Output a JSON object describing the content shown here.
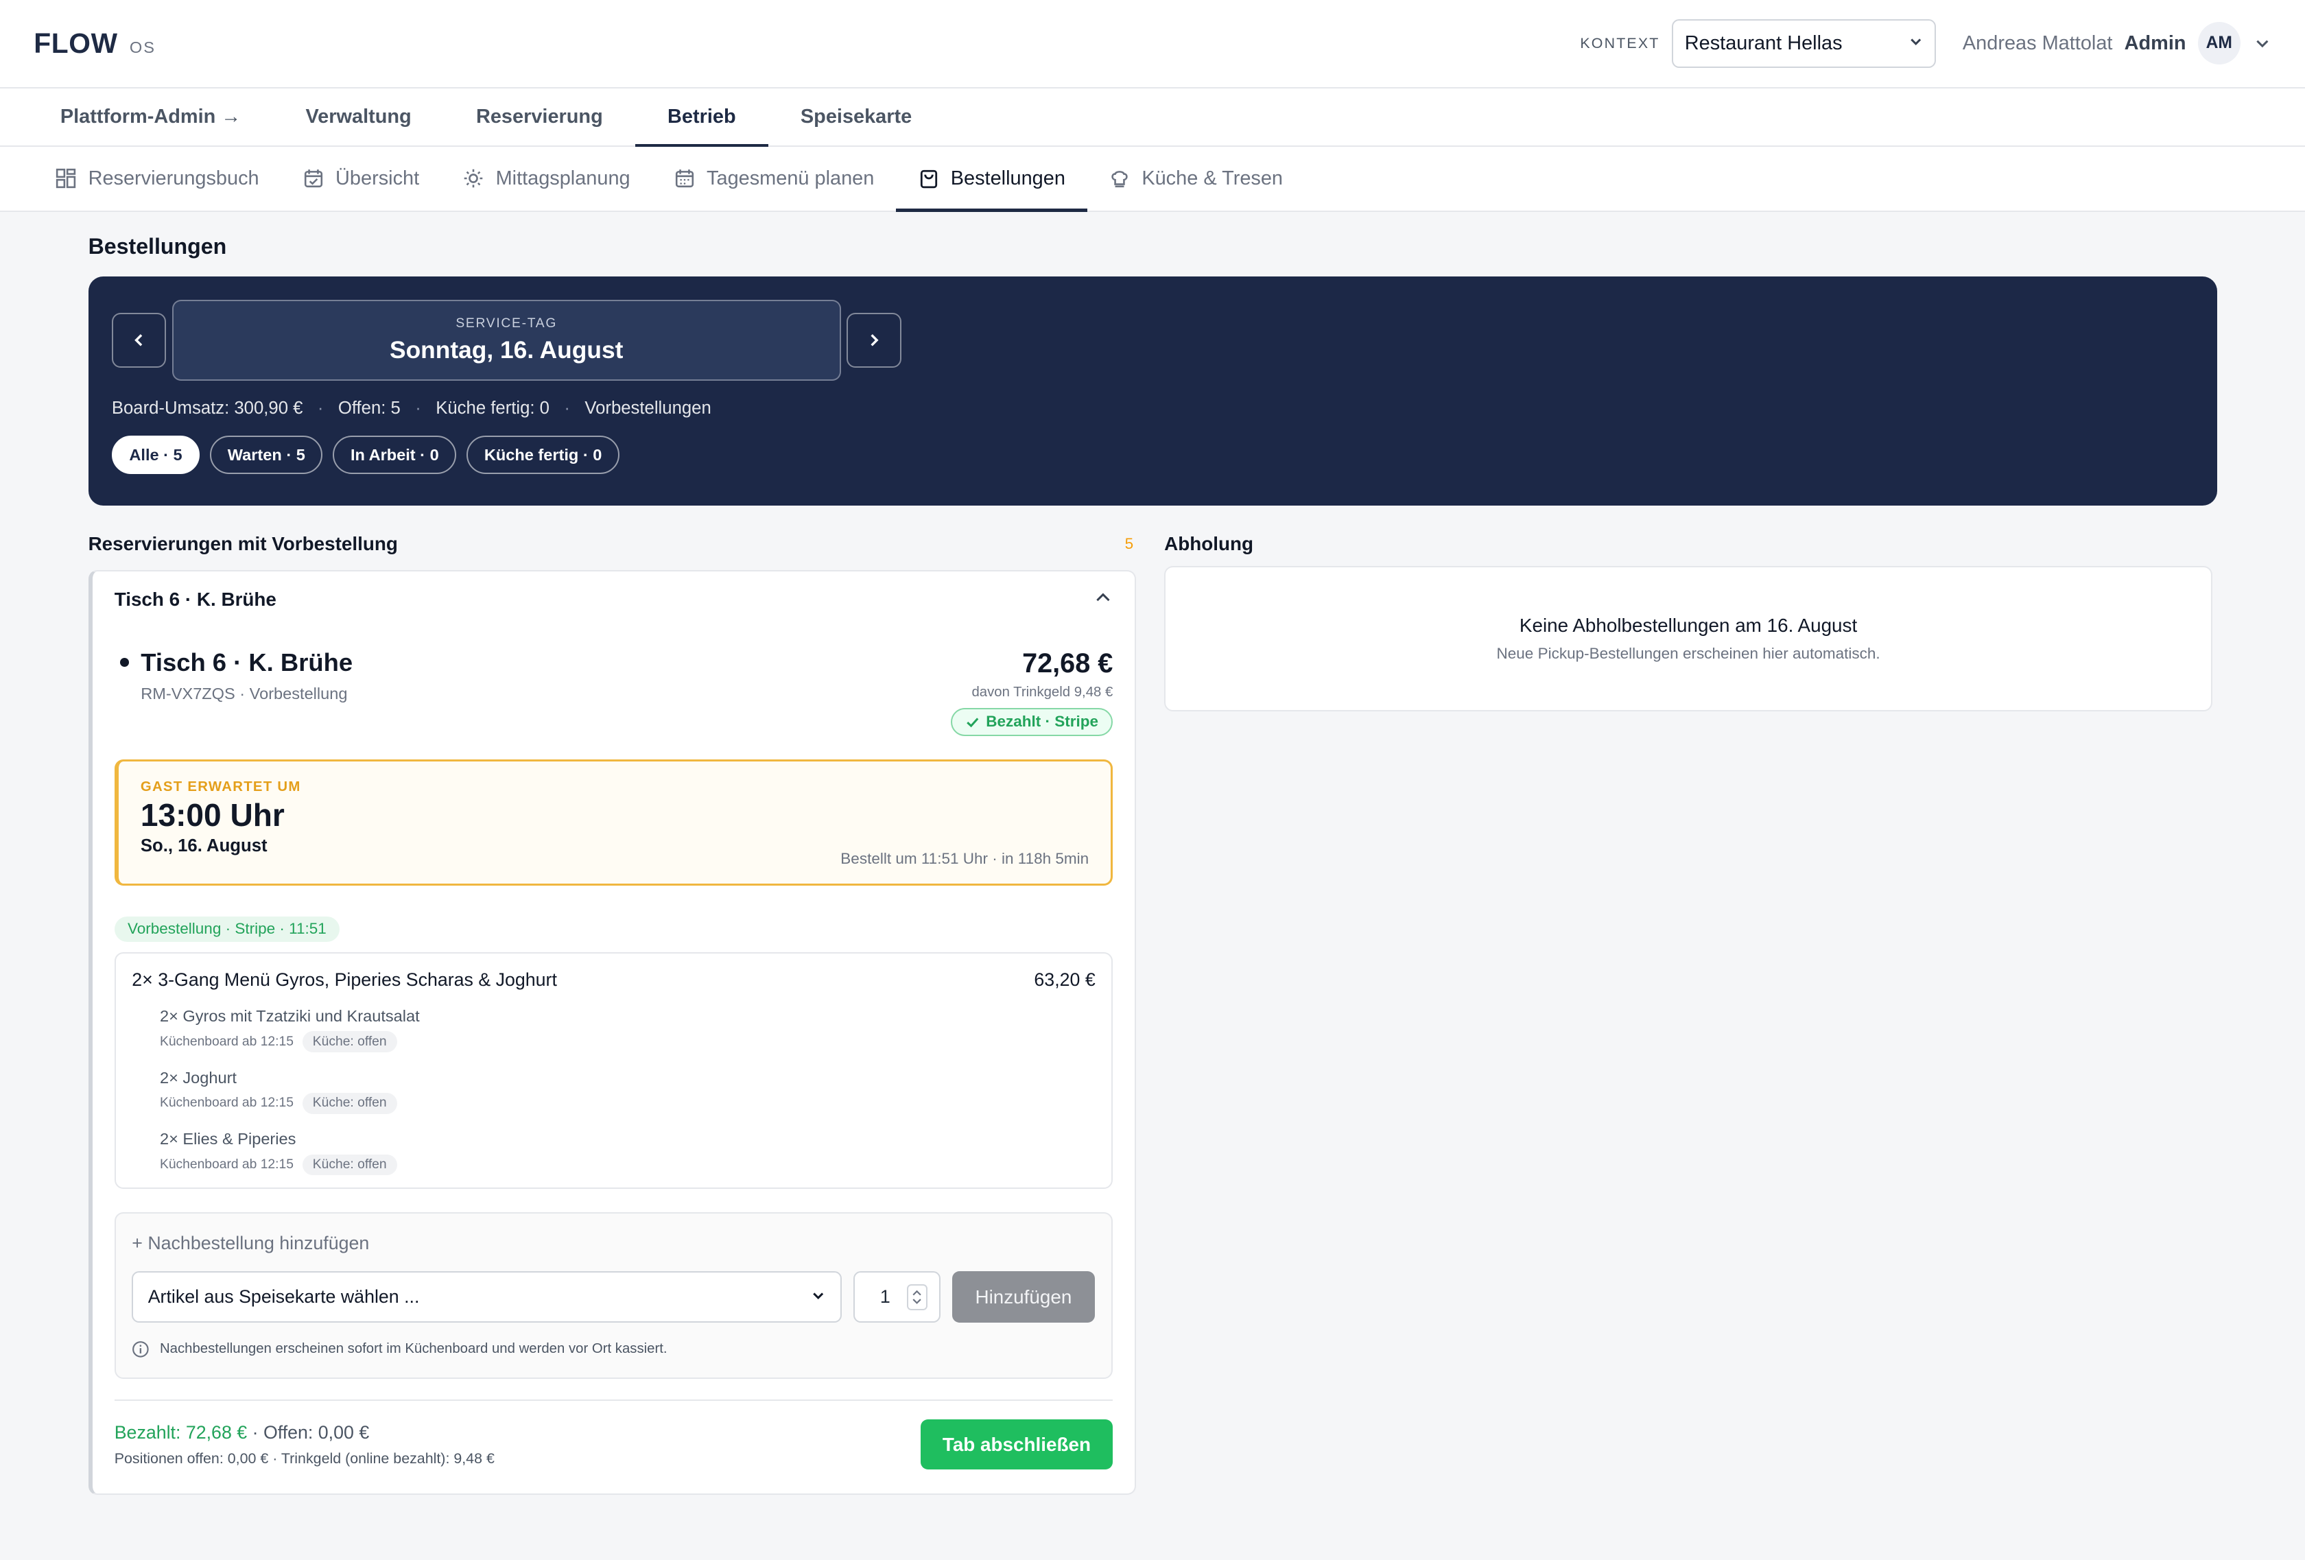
{
  "brand": {
    "name": "FLOW",
    "sub": "OS"
  },
  "context": {
    "label": "KONTEXT",
    "value": "Restaurant Hellas"
  },
  "user": {
    "name": "Andreas Mattolat",
    "role": "Admin",
    "initials": "AM"
  },
  "main_nav": [
    {
      "label": "Plattform-Admin →",
      "active": false
    },
    {
      "label": "Verwaltung",
      "active": false
    },
    {
      "label": "Reservierung",
      "active": false
    },
    {
      "label": "Betrieb",
      "active": true
    },
    {
      "label": "Speisekarte",
      "active": false
    }
  ],
  "sub_nav": [
    {
      "label": "Reservierungsbuch",
      "icon": "grid-icon"
    },
    {
      "label": "Übersicht",
      "icon": "calendar-check-icon"
    },
    {
      "label": "Mittagsplanung",
      "icon": "sun-icon"
    },
    {
      "label": "Tagesmenü planen",
      "icon": "calendar-icon"
    },
    {
      "label": "Bestellungen",
      "icon": "shopping-bag-icon",
      "active": true
    },
    {
      "label": "Küche & Tresen",
      "icon": "chef-hat-icon"
    }
  ],
  "page_title": "Bestellungen",
  "service_day": {
    "label": "SERVICE-TAG",
    "value": "Sonntag, 16. August"
  },
  "stats": {
    "revenue": "Board-Umsatz: 300,90 €",
    "open": "Offen: 5",
    "kitchen_done": "Küche fertig: 0",
    "preorders": "Vorbestellungen",
    "separator": "·"
  },
  "filters": [
    {
      "label": "Alle · 5",
      "active": true
    },
    {
      "label": "Warten · 5",
      "active": false
    },
    {
      "label": "In Arbeit · 0",
      "active": false
    },
    {
      "label": "Küche fertig · 0",
      "active": false
    }
  ],
  "reservations": {
    "title": "Reservierungen mit Vorbestellung",
    "count": "5",
    "card": {
      "header": "Tisch 6 · K. Brühe",
      "title": "Tisch 6 · K. Brühe",
      "ref": "RM-VX7ZQS · Vorbestellung",
      "amount": "72,68 €",
      "tip": "davon Trinkgeld 9,48 €",
      "paid_badge": "Bezahlt · Stripe",
      "arrival": {
        "label": "GAST ERWARTET UM",
        "time": "13:00 Uhr",
        "date": "So., 16. August",
        "meta": "Bestellt um 11:51 Uhr · in 118h 5min"
      },
      "pre_tag": "Vorbestellung · Stripe · 11:51",
      "item": {
        "name": "2× 3-Gang Menü Gyros, Piperies Scharas & Joghurt",
        "price": "63,20 €",
        "subitems": [
          {
            "name": "2× Gyros mit Tzatziki und Krautsalat",
            "board": "Küchenboard ab 12:15",
            "status": "Küche: offen"
          },
          {
            "name": "2× Joghurt",
            "board": "Küchenboard ab 12:15",
            "status": "Küche: offen"
          },
          {
            "name": "2× Elies & Piperies",
            "board": "Küchenboard ab 12:15",
            "status": "Küche: offen"
          }
        ]
      },
      "add": {
        "title": "+ Nachbestellung hinzufügen",
        "select_placeholder": "Artikel aus Speisekarte wählen ...",
        "qty": "1",
        "button": "Hinzufügen",
        "hint": "Nachbestellungen erscheinen sofort im Küchenboard und werden vor Ort kassiert."
      },
      "footer": {
        "paid": "Bezahlt: 72,68 €",
        "open": " · Offen: 0,00 €",
        "sub": "Positionen offen: 0,00 € · Trinkgeld (online bezahlt): 9,48 €",
        "close_button": "Tab abschließen"
      }
    }
  },
  "pickup": {
    "title": "Abholung",
    "empty_title": "Keine Abholbestellungen am 16. August",
    "empty_sub": "Neue Pickup-Bestellungen erscheinen hier automatisch."
  },
  "colors": {
    "navy": "#1c2847",
    "green": "#1fbe5f",
    "amber": "#f0b73f"
  }
}
